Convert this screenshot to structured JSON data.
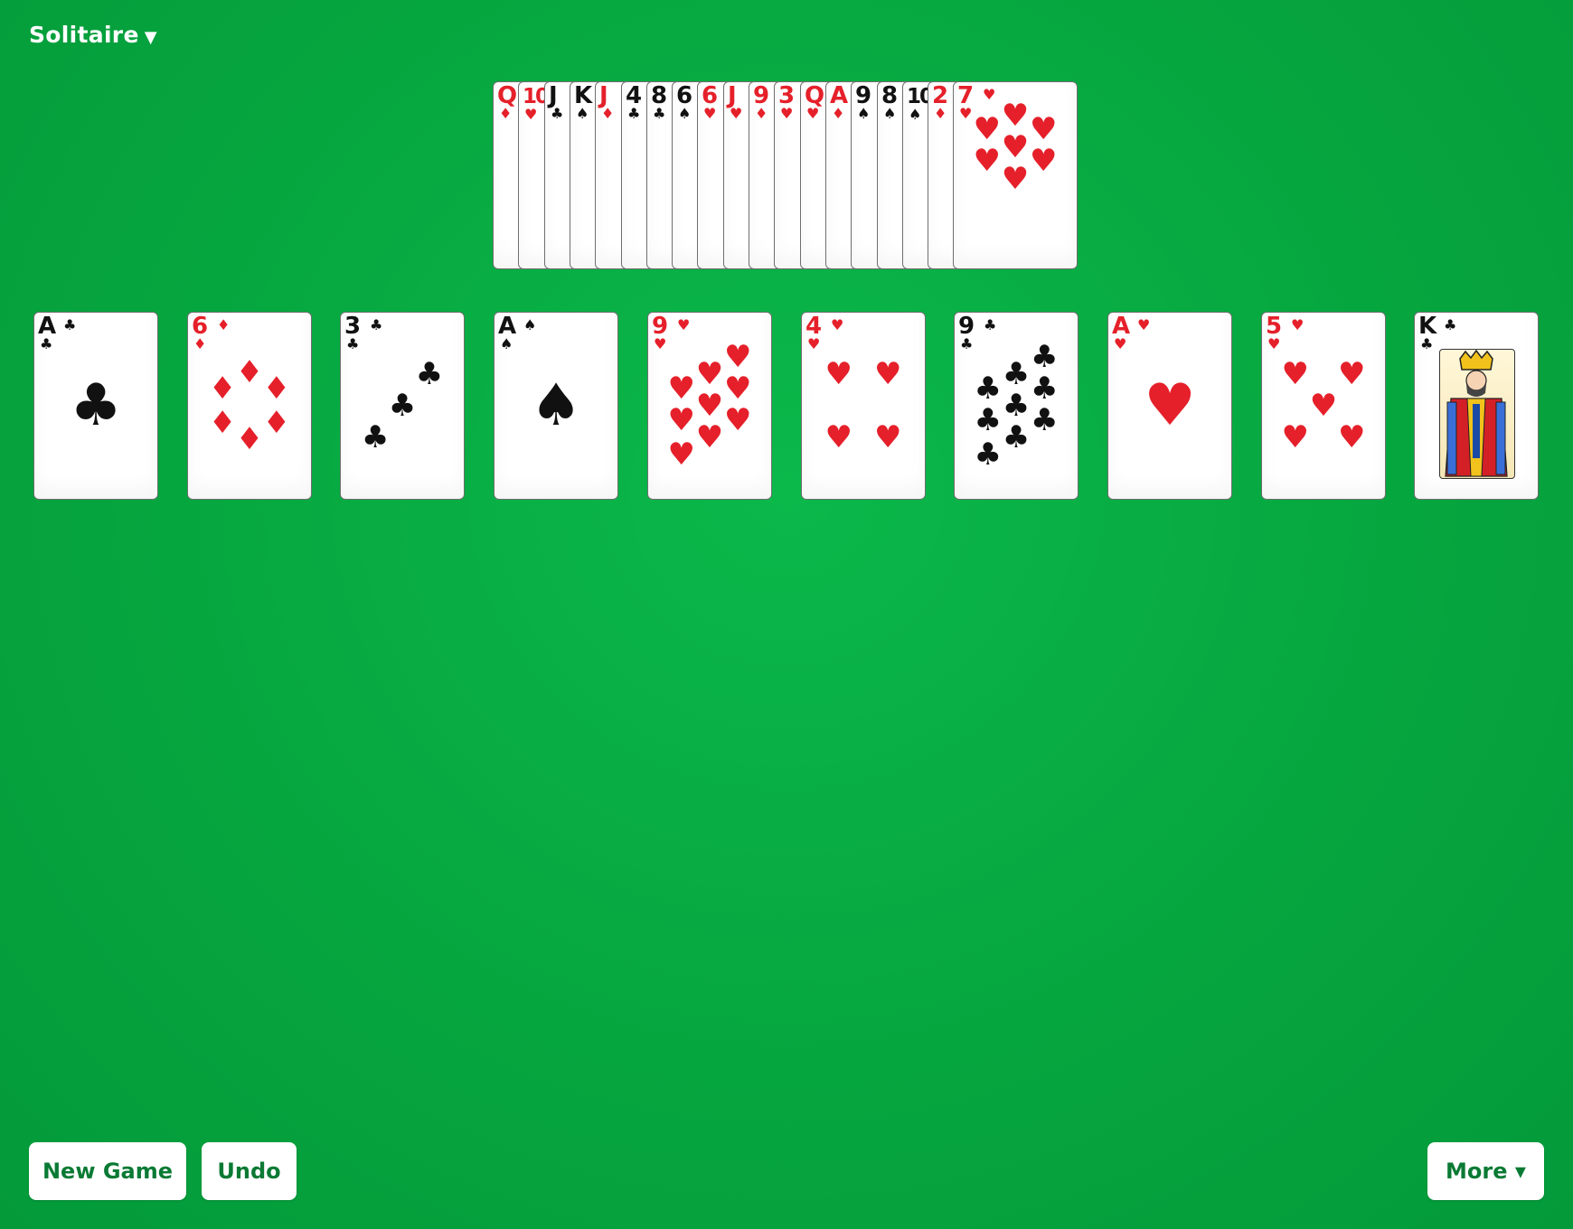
{
  "header": {
    "game_title": "Solitaire",
    "caret": "▼"
  },
  "suits": {
    "hearts": "♥",
    "diamonds": "♦",
    "clubs": "♣",
    "spades": "♠"
  },
  "colors": {
    "felt": "#06a63f",
    "red": "#e5202a",
    "black": "#111111",
    "button_text": "#0a7a34"
  },
  "stock": [
    {
      "rank": "Q",
      "suit": "diamonds"
    },
    {
      "rank": "10",
      "suit": "hearts"
    },
    {
      "rank": "J",
      "suit": "clubs"
    },
    {
      "rank": "K",
      "suit": "spades"
    },
    {
      "rank": "J",
      "suit": "diamonds"
    },
    {
      "rank": "4",
      "suit": "clubs"
    },
    {
      "rank": "8",
      "suit": "clubs"
    },
    {
      "rank": "6",
      "suit": "spades"
    },
    {
      "rank": "6",
      "suit": "hearts"
    },
    {
      "rank": "J",
      "suit": "hearts"
    },
    {
      "rank": "9",
      "suit": "diamonds"
    },
    {
      "rank": "3",
      "suit": "hearts"
    },
    {
      "rank": "Q",
      "suit": "hearts"
    },
    {
      "rank": "A",
      "suit": "diamonds"
    },
    {
      "rank": "9",
      "suit": "spades"
    },
    {
      "rank": "8",
      "suit": "spades"
    },
    {
      "rank": "10",
      "suit": "spades"
    },
    {
      "rank": "2",
      "suit": "diamonds"
    },
    {
      "rank": "7",
      "suit": "hearts"
    }
  ],
  "tableau": [
    {
      "rank": "A",
      "suit": "clubs"
    },
    {
      "rank": "6",
      "suit": "diamonds"
    },
    {
      "rank": "3",
      "suit": "clubs"
    },
    {
      "rank": "A",
      "suit": "spades"
    },
    {
      "rank": "9",
      "suit": "hearts"
    },
    {
      "rank": "4",
      "suit": "hearts"
    },
    {
      "rank": "9",
      "suit": "clubs"
    },
    {
      "rank": "A",
      "suit": "hearts"
    },
    {
      "rank": "5",
      "suit": "hearts"
    },
    {
      "rank": "K",
      "suit": "clubs"
    }
  ],
  "buttons": {
    "new_game": "New Game",
    "undo": "Undo",
    "more": "More ▾"
  }
}
